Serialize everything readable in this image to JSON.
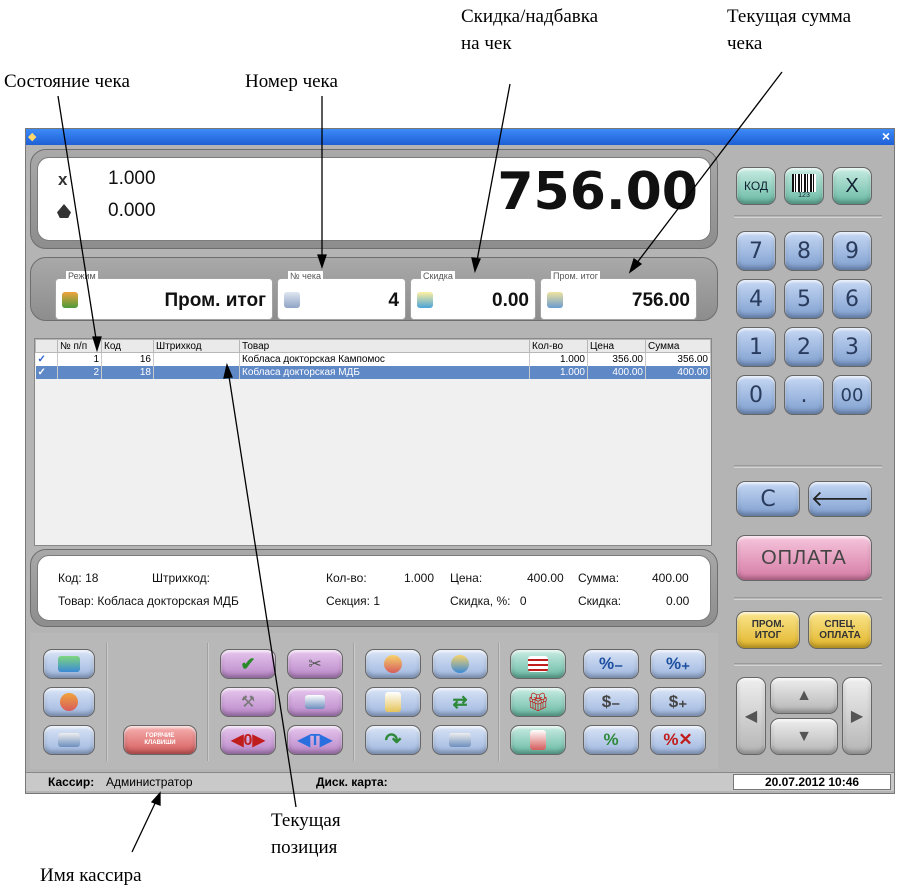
{
  "annotations": {
    "discount": "Скидка/надбавка\nна чек",
    "current_sum": "Текущая сумма\nчека",
    "receipt_state": "Состояние чека",
    "receipt_number": "Номер чека",
    "current_position": "Текущая\nпозиция",
    "cashier_name": "Имя кассира"
  },
  "top_display": {
    "x_symbol": "x",
    "quantity": "1.000",
    "weight": "0.000",
    "total": "756.00"
  },
  "info_bar": {
    "mode_label": "Режим",
    "mode_value": "Пром. итог",
    "receipt_no_label": "№ чека",
    "receipt_no_value": "4",
    "discount_label": "Скидка",
    "discount_value": "0.00",
    "subtotal_label": "Пром. итог",
    "subtotal_value": "756.00"
  },
  "table": {
    "headers": [
      "№ п/п",
      "Код",
      "Штрихкод",
      "Товар",
      "Кол-во",
      "Цена",
      "Сумма"
    ],
    "rows": [
      {
        "check": "✓",
        "n": "1",
        "code": "16",
        "barcode": "",
        "name": "Кобласа докторская Кампомос",
        "qty": "1.000",
        "price": "356.00",
        "sum": "356.00"
      },
      {
        "check": "✓",
        "n": "2",
        "code": "18",
        "barcode": "",
        "name": "Кобласа докторская МДБ",
        "qty": "1.000",
        "price": "400.00",
        "sum": "400.00"
      }
    ]
  },
  "details": {
    "code_label": "Код:",
    "code_value": "18",
    "barcode_label": "Штрихкод:",
    "qty_label": "Кол-во:",
    "qty_value": "1.000",
    "price_label": "Цена:",
    "price_value": "400.00",
    "sum_label": "Сумма:",
    "sum_value": "400.00",
    "item_label": "Товар:",
    "item_value": "Кобласа докторская МДБ",
    "section_label": "Секция:",
    "section_value": "1",
    "discount_pct_label": "Скидка, %:",
    "discount_pct_value": "0",
    "discount_label": "Скидка:",
    "discount_value": "0.00"
  },
  "keypad": {
    "top": [
      "КОД",
      "123",
      "X"
    ],
    "digits": [
      "7",
      "8",
      "9",
      "4",
      "5",
      "6",
      "1",
      "2",
      "3",
      "0",
      ".",
      "00"
    ],
    "clear": "C",
    "pay": "ОПЛАТА",
    "subtotal_btn": [
      "ПРОМ.",
      "ИТОГ"
    ],
    "special_pay_btn": [
      "СПЕЦ.",
      "ОПЛАТА"
    ]
  },
  "hotkeys_btn": [
    "ГОРЯЧИЕ",
    "КЛАВИШИ"
  ],
  "status": {
    "cashier_label": "Кассир:",
    "cashier_value": "Администратор",
    "card_label": "Диск. карта:",
    "datetime": "20.07.2012 10:46"
  },
  "colors": {
    "selected_row": "#5f88c6",
    "title_bar": "#2a6fe0",
    "keypad_blue": "#8ea9d6",
    "pay_pink": "#d57aa4",
    "yellow_btn": "#e1b52b"
  }
}
